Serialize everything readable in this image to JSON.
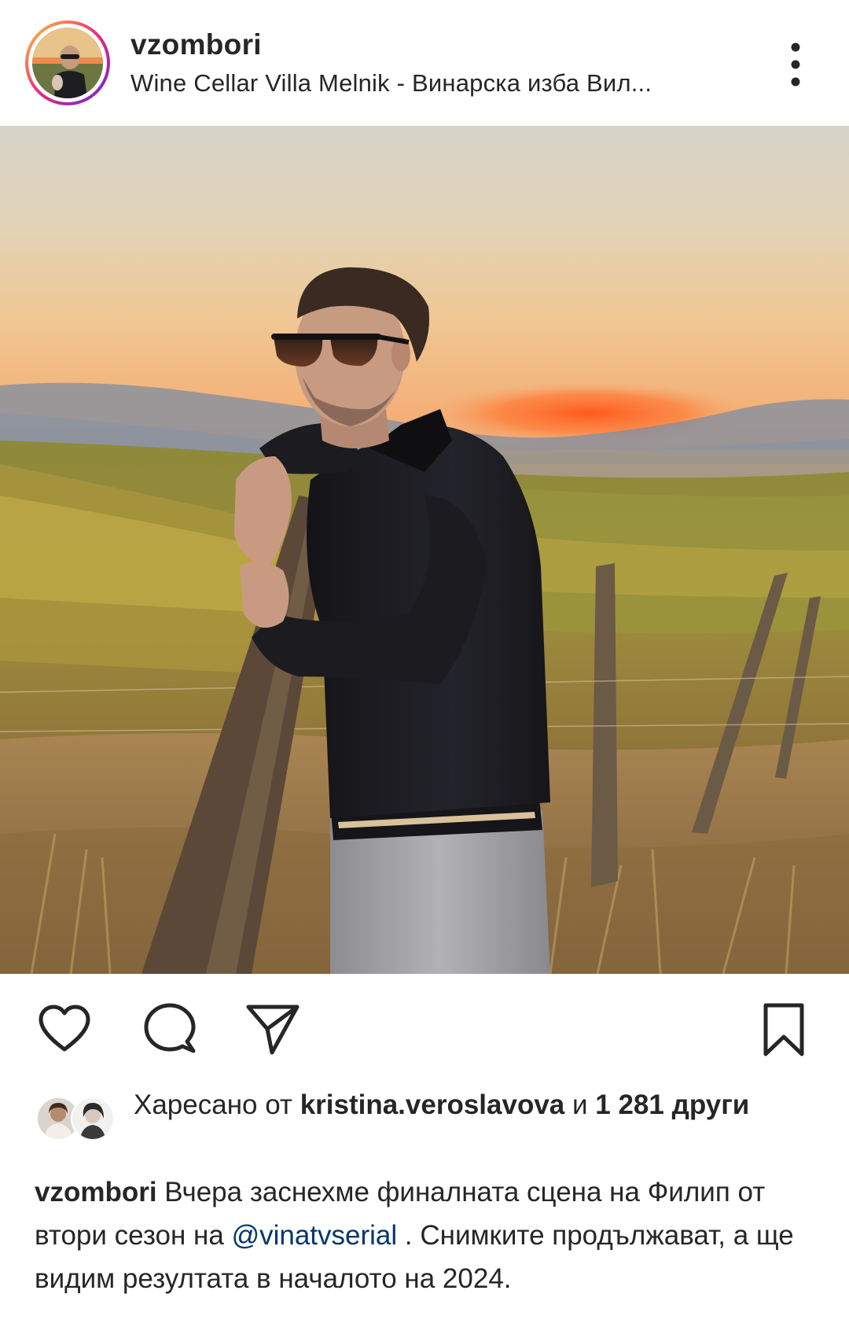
{
  "post": {
    "username": "vzombori",
    "location": "Wine Cellar Villa Melnik - Винарска изба Вил..."
  },
  "actions": {
    "like_icon": "heart-icon",
    "comment_icon": "comment-icon",
    "share_icon": "paper-plane-icon",
    "save_icon": "bookmark-icon"
  },
  "likes": {
    "prefix": "Харесано от ",
    "user": "kristina.veroslavova",
    "connector": " и ",
    "count": "1 281",
    "suffix": "други"
  },
  "caption": {
    "username": "vzombori",
    "text_before": " Вчера заснехме финалната сцена на Филип от втори сезон на ",
    "mention": "@vinatvserial",
    "text_after": " . Снимките продължават, а ще видим резултата в началото на 2024."
  },
  "colors": {
    "text": "#262626",
    "mention": "#00376b",
    "story_ring_start": "#f9ce34",
    "story_ring_mid": "#ee2a7b",
    "story_ring_end": "#6228d7"
  }
}
